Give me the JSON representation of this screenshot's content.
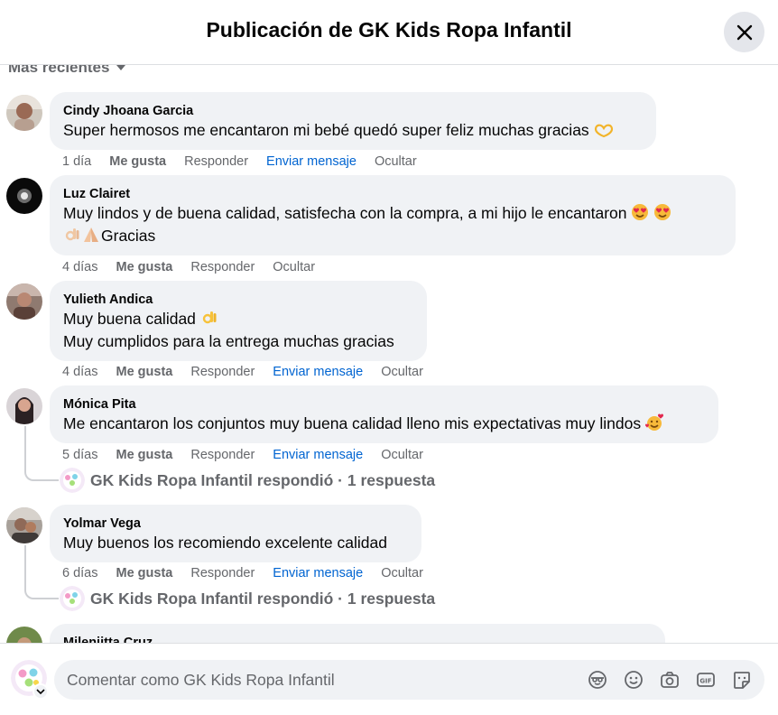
{
  "header": {
    "title": "Publicación de GK Kids Ropa Infantil"
  },
  "sort": {
    "label": "Más recientes"
  },
  "comments": [
    {
      "author": "Cindy Jhoana Garcia",
      "lines": [
        "Super hermosos me encantaron mi bebé quedó super feliz muchas gracias"
      ],
      "time": "1 día",
      "like": "Me gusta",
      "reply": "Responder",
      "message": "Enviar mensaje",
      "hide": "Ocultar"
    },
    {
      "author": "Luz Clairet",
      "lines": [
        "Muy lindos y de buena calidad, satisfecha con la compra, a mi hijo le encantaron",
        "Gracias"
      ],
      "time": "4 días",
      "like": "Me gusta",
      "reply": "Responder",
      "hide": "Ocultar"
    },
    {
      "author": "Yulieth Andica",
      "lines": [
        "Muy buena calidad",
        "Muy cumplidos para la entrega muchas gracias"
      ],
      "time": "4 días",
      "like": "Me gusta",
      "reply": "Responder",
      "message": "Enviar mensaje",
      "hide": "Ocultar"
    },
    {
      "author": "Mónica Pita",
      "lines": [
        "Me encantaron los conjuntos muy buena calidad lleno mis expectativas muy lindos"
      ],
      "time": "5 días",
      "like": "Me gusta",
      "reply": "Responder",
      "message": "Enviar mensaje",
      "hide": "Ocultar",
      "replies": "GK Kids Ropa Infantil respondió · 1 respuesta"
    },
    {
      "author": "Yolmar Vega",
      "lines": [
        "Muy buenos los recomiendo excelente calidad"
      ],
      "time": "6 días",
      "like": "Me gusta",
      "reply": "Responder",
      "message": "Enviar mensaje",
      "hide": "Ocultar",
      "replies": "GK Kids Ropa Infantil respondió · 1 respuesta"
    },
    {
      "author": "Milenjitta Cruz"
    }
  ],
  "composer": {
    "placeholder": "Comentar como GK Kids Ropa Infantil"
  },
  "colors": {
    "bubble": "#f0f2f5",
    "link": "#0064d1",
    "secondary_text": "#65676b"
  },
  "icons": [
    "close-icon",
    "emoji-icon",
    "camera-icon",
    "gif-icon",
    "sticker-icon",
    "avatar-sticker-icon"
  ]
}
